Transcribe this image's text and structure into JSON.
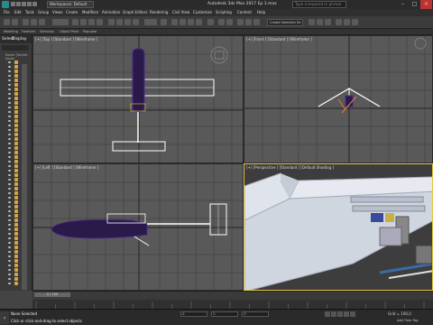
{
  "titlebar": {
    "workspace": "Workspaces: Default",
    "title": "Autodesk 3ds Max 2017    Ep 1.max",
    "search_placeholder": "Type a keyword or phrase"
  },
  "menu": [
    "File",
    "Edit",
    "Tools",
    "Group",
    "Views",
    "Create",
    "Modifiers",
    "Animation",
    "Graph Editors",
    "Rendering",
    "Civil View",
    "Customize",
    "Scripting",
    "Content",
    "Help"
  ],
  "toolbar": {
    "selection_set": "Create Selection Se"
  },
  "ribbon": [
    "Modeling",
    "Freeform",
    "Selection",
    "Object Paint",
    "Populate"
  ],
  "scene_explorer": {
    "tabs": [
      "Select",
      "Display"
    ],
    "column_header": "Name (Sorted Ascen"
  },
  "viewports": {
    "top": "[+] [Top ] [Standard ] [Wireframe ]",
    "front": "[+] [Front ] [Standard ] [Wireframe ]",
    "left": "[+] [Left ] [Standard ] [Wireframe ]",
    "perspective": "[+] [Perspective ] [Standard ] [Default Shading ]"
  },
  "timeline": {
    "frame": "0 / 100"
  },
  "status": {
    "selection": "None Selected",
    "prompt": "Click or click-and-drag to select objects",
    "grid": "Grid = 100,0",
    "add_time_tag": "Add Time Tag"
  },
  "colors": {
    "active_viewport": "#e8c33d",
    "wire_white": "#ffffff",
    "wire_purple": "#4a2a8a"
  }
}
